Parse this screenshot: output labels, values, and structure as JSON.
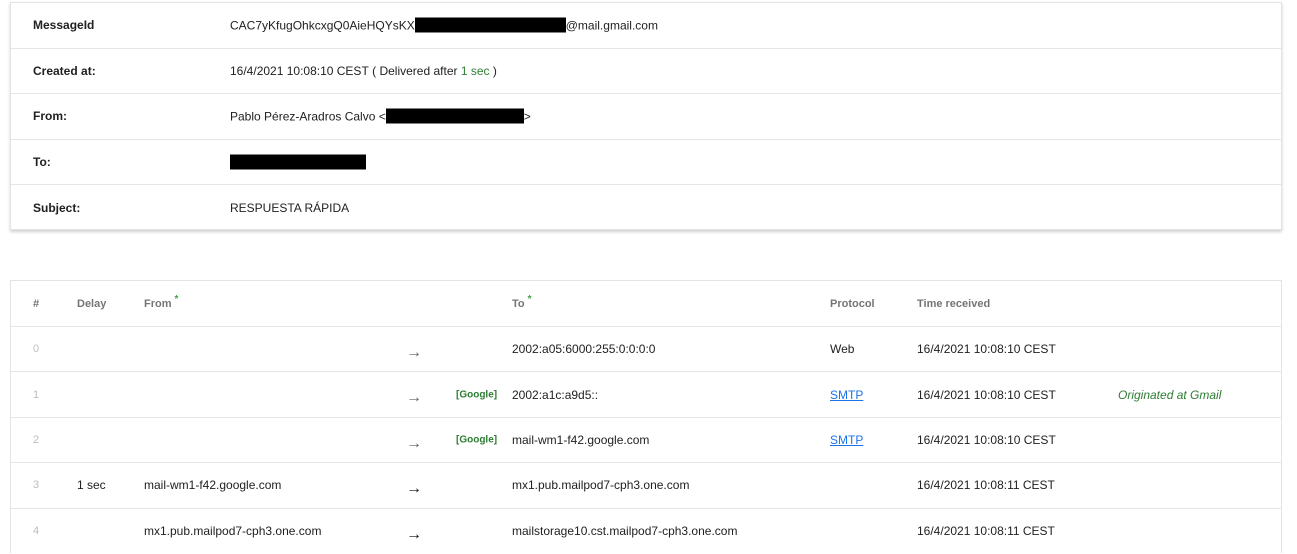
{
  "header": {
    "message_id": {
      "label": "MessageId",
      "prefix": "CAC7yKfugOhkcxgQ0AieHQYsKX",
      "suffix": "@mail.gmail.com"
    },
    "created_at": {
      "label": "Created at:",
      "value": "16/4/2021 10:08:10 CEST",
      "delivered_prefix": "( Delivered after",
      "delivered_time": "1 sec",
      "delivered_suffix": ")"
    },
    "from": {
      "label": "From:",
      "name": "Pablo Pérez-Aradros Calvo <",
      "suffix": ">"
    },
    "to": {
      "label": "To:"
    },
    "subject": {
      "label": "Subject:",
      "value": "RESPUESTA RÁPIDA"
    }
  },
  "hops_table": {
    "columns": {
      "num": "#",
      "delay": "Delay",
      "from": "From",
      "to": "To",
      "protocol": "Protocol",
      "time": "Time received"
    },
    "star": "*",
    "arrow": "→",
    "rows": [
      {
        "num": "0",
        "delay": "",
        "from": "",
        "tag": "",
        "to": "2002:a05:6000:255:0:0:0:0",
        "protocol": "Web",
        "time": "16/4/2021 10:08:10 CEST",
        "note": ""
      },
      {
        "num": "1",
        "delay": "",
        "from": "",
        "tag": "[Google]",
        "to": "2002:a1c:a9d5::",
        "protocol": "SMTP",
        "time": "16/4/2021 10:08:10 CEST",
        "note": "Originated at Gmail"
      },
      {
        "num": "2",
        "delay": "",
        "from": "",
        "tag": "[Google]",
        "to": "mail-wm1-f42.google.com",
        "protocol": "SMTP",
        "time": "16/4/2021 10:08:10 CEST",
        "note": ""
      },
      {
        "num": "3",
        "delay": "1 sec",
        "from": "mail-wm1-f42.google.com",
        "tag": "",
        "to": "mx1.pub.mailpod7-cph3.one.com",
        "protocol": "",
        "time": "16/4/2021 10:08:11 CEST",
        "note": ""
      },
      {
        "num": "4",
        "delay": "",
        "from": "mx1.pub.mailpod7-cph3.one.com",
        "tag": "",
        "to": "mailstorage10.cst.mailpod7-cph3.one.com",
        "protocol": "",
        "time": "16/4/2021 10:08:11 CEST",
        "note": ""
      }
    ]
  },
  "colors": {
    "accent_green": "#2e7d32",
    "link_blue": "#1a73e8",
    "redaction": "#000000"
  }
}
